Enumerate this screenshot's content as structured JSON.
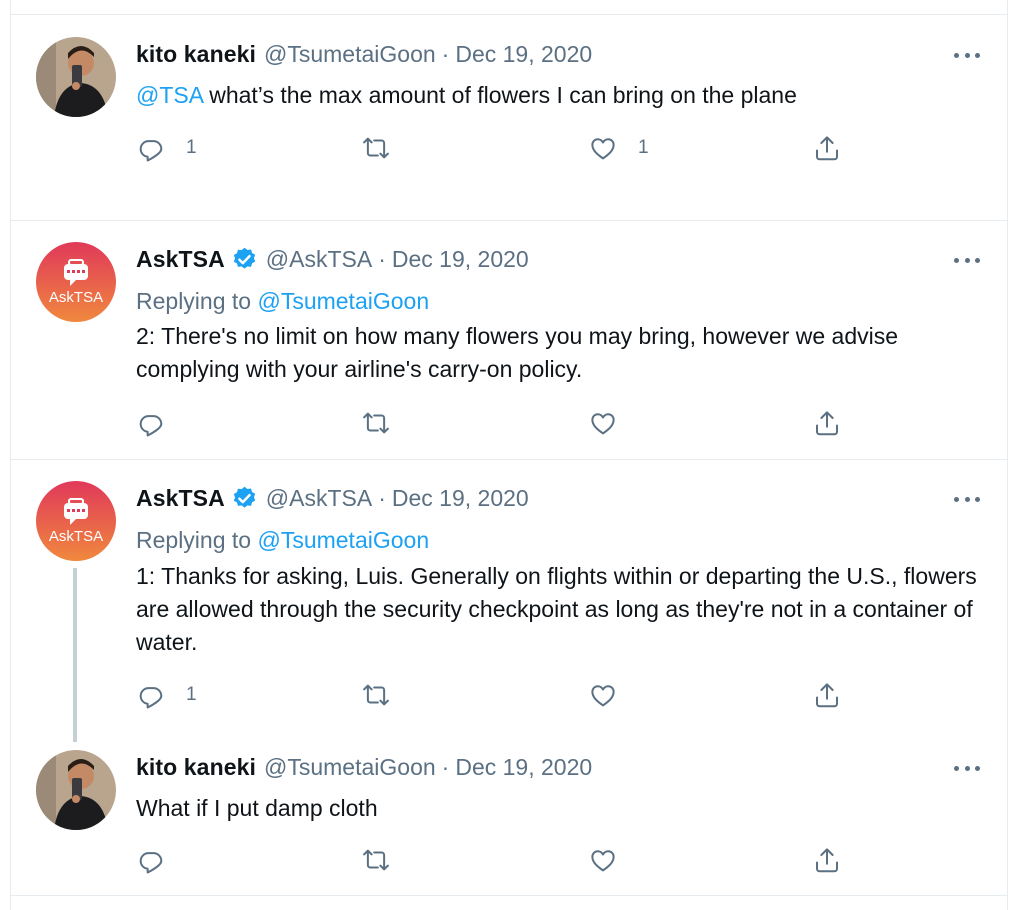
{
  "tweets": [
    {
      "name": "kito kaneki",
      "handle": "@TsumetaiGoon",
      "sep": "·",
      "date": "Dec 19, 2020",
      "verified": false,
      "mention": "@TSA",
      "text": " what’s the max amount of flowers I can bring on the plane",
      "reply_count": "1",
      "retweet_count": "",
      "like_count": "1"
    },
    {
      "name": "AskTSA",
      "handle": "@AskTSA",
      "sep": "·",
      "date": "Dec 19, 2020",
      "verified": true,
      "replying_prefix": "Replying to ",
      "replying_to": "@TsumetaiGoon",
      "text": "2: There's no limit on how many flowers you may bring, however we advise complying with your airline's carry-on policy.",
      "reply_count": "",
      "retweet_count": "",
      "like_count": ""
    },
    {
      "name": "AskTSA",
      "handle": "@AskTSA",
      "sep": "·",
      "date": "Dec 19, 2020",
      "verified": true,
      "replying_prefix": "Replying to ",
      "replying_to": "@TsumetaiGoon",
      "text": "1: Thanks for asking, Luis. Generally on flights within or departing the U.S., flowers are allowed through the security checkpoint as long as they're not in a container of water.",
      "reply_count": "1",
      "retweet_count": "",
      "like_count": ""
    },
    {
      "name": "kito kaneki",
      "handle": "@TsumetaiGoon",
      "sep": "·",
      "date": "Dec 19, 2020",
      "verified": false,
      "text": "What if I put damp cloth",
      "reply_count": "",
      "retweet_count": "",
      "like_count": ""
    }
  ],
  "asktsa_logo_text": "AskTSA",
  "colors": {
    "accent": "#1da1f2",
    "secondary_text": "#5b7083",
    "border": "#e6ecf0",
    "asktsa_gradient_top": "#e0395a",
    "asktsa_gradient_bottom": "#f0883e"
  },
  "icons": {
    "reply": "reply-icon",
    "retweet": "retweet-icon",
    "like": "heart-icon",
    "share": "share-icon",
    "more": "more-icon",
    "verified": "verified-badge-icon"
  }
}
